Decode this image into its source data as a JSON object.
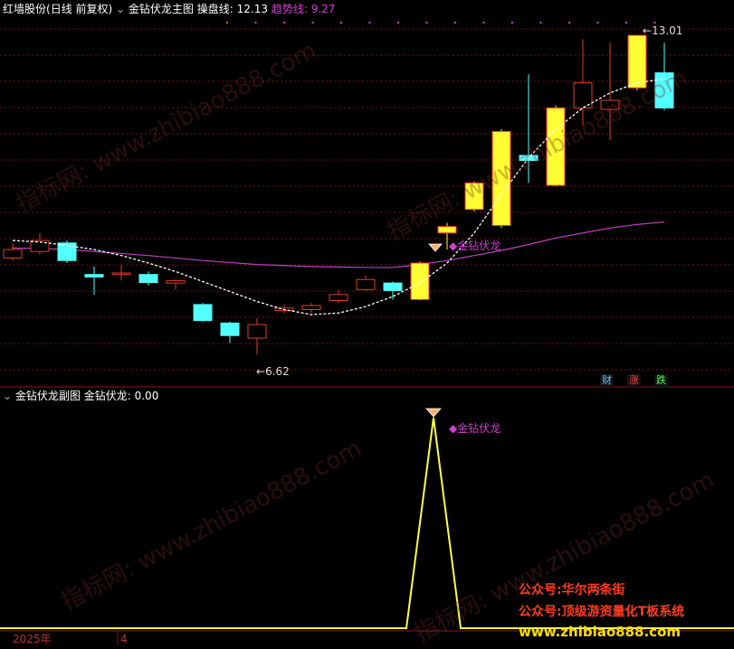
{
  "header": {
    "stock": "红墙股份",
    "mode": "(日线 前复权)",
    "indicator": "金钻伏龙主图",
    "line1_label": "操盘线:",
    "line1_value": "12.13",
    "line2_label": "趋势线:",
    "line2_value": "9.27"
  },
  "sub_header": {
    "indicator": "金钻伏龙副图",
    "label": "金钻伏龙:",
    "value": "0.00"
  },
  "annotations": {
    "high": "13.01",
    "low": "6.62",
    "signal_main": "金钻伏龙",
    "signal_sub": "金钻伏龙"
  },
  "buttons": {
    "cai": "财",
    "zhang": "涨",
    "die": "跌"
  },
  "axis": {
    "year": "2025年",
    "month": "4"
  },
  "watermarks": [
    "指标网: www.zhibiao888.com",
    "指标网: www.zhibiao888.com",
    "指标网: www.zhibiao888.com",
    "指标网: www.zhibiao888.com"
  ],
  "promo": {
    "line1": "公众号:华尔两条街",
    "line2": "公众号:顶级游资量化T板系统",
    "line3": "www.zhibiao888.com"
  },
  "colors": {
    "up": "#e0402a",
    "down": "#54ffff",
    "signal": "#ffff33",
    "ma": "#c040c0",
    "trend": "#ffffff",
    "sub_line": "#ffff44"
  },
  "chart_data": [
    {
      "type": "candlestick",
      "title": "金钻伏龙主图",
      "ylim": [
        6.3,
        13.2
      ],
      "candles": [
        {
          "o": 8.55,
          "c": 8.72,
          "h": 8.85,
          "l": 8.5,
          "color": "up"
        },
        {
          "o": 8.68,
          "c": 8.9,
          "h": 9.05,
          "l": 8.62,
          "color": "up"
        },
        {
          "o": 8.85,
          "c": 8.5,
          "h": 8.9,
          "l": 8.45,
          "color": "down"
        },
        {
          "o": 8.22,
          "c": 8.17,
          "h": 8.38,
          "l": 7.82,
          "color": "down"
        },
        {
          "o": 8.25,
          "c": 8.22,
          "h": 8.42,
          "l": 8.1,
          "color": "up"
        },
        {
          "o": 8.22,
          "c": 8.06,
          "h": 8.28,
          "l": 8.0,
          "color": "down"
        },
        {
          "o": 8.05,
          "c": 8.1,
          "h": 8.12,
          "l": 7.92,
          "color": "up"
        },
        {
          "o": 7.62,
          "c": 7.3,
          "h": 7.65,
          "l": 7.28,
          "color": "down"
        },
        {
          "o": 7.25,
          "c": 7.0,
          "h": 7.28,
          "l": 6.85,
          "color": "down"
        },
        {
          "o": 6.95,
          "c": 7.22,
          "h": 7.35,
          "l": 6.62,
          "color": "up"
        },
        {
          "o": 7.5,
          "c": 7.55,
          "h": 7.62,
          "l": 7.45,
          "color": "up"
        },
        {
          "o": 7.52,
          "c": 7.6,
          "h": 7.65,
          "l": 7.46,
          "color": "up"
        },
        {
          "o": 7.7,
          "c": 7.82,
          "h": 7.92,
          "l": 7.65,
          "color": "up"
        },
        {
          "o": 7.92,
          "c": 8.12,
          "h": 8.2,
          "l": 7.88,
          "color": "up"
        },
        {
          "o": 8.05,
          "c": 7.9,
          "h": 8.08,
          "l": 7.72,
          "color": "down"
        },
        {
          "o": 7.72,
          "c": 8.45,
          "h": 8.48,
          "l": 7.7,
          "color": "signal"
        },
        {
          "o": 9.05,
          "c": 9.18,
          "h": 9.25,
          "l": 8.72,
          "color": "signal"
        },
        {
          "o": 9.52,
          "c": 10.05,
          "h": 10.08,
          "l": 9.48,
          "color": "signal"
        },
        {
          "o": 9.2,
          "c": 11.08,
          "h": 11.12,
          "l": 9.15,
          "color": "signal"
        },
        {
          "o": 10.6,
          "c": 10.5,
          "h": 12.22,
          "l": 10.05,
          "color": "down"
        },
        {
          "o": 10.0,
          "c": 11.55,
          "h": 11.6,
          "l": 9.98,
          "color": "signal"
        },
        {
          "o": 11.55,
          "c": 12.05,
          "h": 12.92,
          "l": 11.2,
          "color": "up"
        },
        {
          "o": 11.7,
          "c": 11.52,
          "h": 12.85,
          "l": 10.9,
          "color": "up"
        },
        {
          "o": 13.0,
          "c": 11.95,
          "h": 13.01,
          "l": 11.9,
          "color": "signal"
        },
        {
          "o": 12.25,
          "c": 11.55,
          "h": 12.85,
          "l": 11.5,
          "color": "down"
        }
      ],
      "operating_line": [
        8.9,
        8.87,
        8.8,
        8.72,
        8.6,
        8.45,
        8.28,
        8.08,
        7.88,
        7.68,
        7.52,
        7.42,
        7.45,
        7.58,
        7.78,
        8.05,
        8.45,
        9.05,
        9.82,
        10.55,
        11.12,
        11.55,
        11.85,
        12.05,
        12.13
      ],
      "trend_line": [
        8.75,
        8.74,
        8.72,
        8.68,
        8.64,
        8.6,
        8.55,
        8.5,
        8.46,
        8.42,
        8.4,
        8.38,
        8.37,
        8.36,
        8.36,
        8.42,
        8.5,
        8.6,
        8.7,
        8.82,
        8.95,
        9.05,
        9.15,
        9.22,
        9.27
      ],
      "signal_index": 16
    },
    {
      "type": "line",
      "title": "金钻伏龙副图",
      "ylim": [
        0,
        1
      ],
      "values": [
        0,
        0,
        0,
        0,
        0,
        0,
        0,
        0,
        0,
        0,
        0,
        0,
        0,
        0,
        0,
        0,
        1,
        0,
        0,
        0,
        0,
        0,
        0,
        0,
        0
      ]
    }
  ]
}
